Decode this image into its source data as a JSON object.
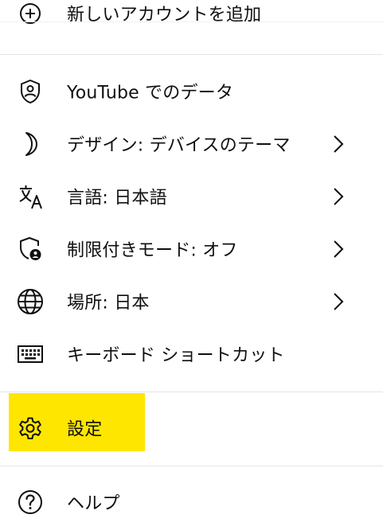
{
  "colors": {
    "highlight": "#ffe600",
    "divider": "#e5e5e5",
    "text": "#0f0f0f"
  },
  "menu": {
    "partial_item": {
      "label": "新しいアカウントを追加",
      "icon": "add-account-icon"
    },
    "items": [
      {
        "label": "YouTube でのデータ",
        "icon": "shield-person-icon",
        "has_chevron": false
      },
      {
        "label": "デザイン: デバイスのテーマ",
        "icon": "moon-icon",
        "has_chevron": true
      },
      {
        "label": "言語: 日本語",
        "icon": "translate-icon",
        "has_chevron": true
      },
      {
        "label": "制限付きモード: オフ",
        "icon": "restricted-mode-icon",
        "has_chevron": true
      },
      {
        "label": "場所: 日本",
        "icon": "globe-icon",
        "has_chevron": true
      },
      {
        "label": "キーボード ショートカット",
        "icon": "keyboard-icon",
        "has_chevron": false
      },
      {
        "label": "設定",
        "icon": "gear-icon",
        "has_chevron": false,
        "highlighted": true
      },
      {
        "label": "ヘルプ",
        "icon": "help-icon",
        "has_chevron": false
      }
    ]
  }
}
